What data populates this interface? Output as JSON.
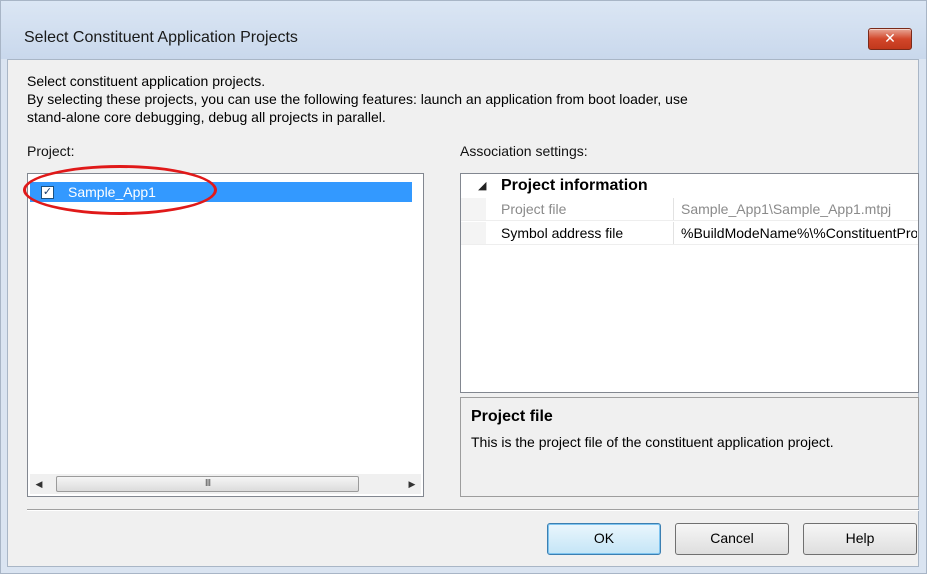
{
  "window": {
    "title": "Select Constituent Application Projects",
    "close_glyph": "✕"
  },
  "description": {
    "line1": "Select constituent application projects.",
    "line2": "By selecting these projects, you can use the following features: launch an application from boot loader, use",
    "line3": "stand-alone core debugging, debug all projects in parallel."
  },
  "project_panel": {
    "label": "Project:",
    "items": [
      {
        "name": "Sample_App1",
        "checked": true,
        "check_glyph": "✓"
      }
    ],
    "scroll_thumb_glyph": "III",
    "scroll_left_glyph": "◀",
    "scroll_right_glyph": "▶"
  },
  "association_panel": {
    "label": "Association settings:",
    "category": "Project information",
    "collapse_glyph": "◢",
    "rows": [
      {
        "key": "Project file",
        "value": "Sample_App1\\Sample_App1.mtpj",
        "disabled": true
      },
      {
        "key": "Symbol address file",
        "value": "%BuildModeName%\\%ConstituentProject%",
        "disabled": false
      }
    ]
  },
  "property_description": {
    "title": "Project file",
    "text": "This is the project file of the constituent application project."
  },
  "buttons": {
    "ok": "OK",
    "cancel": "Cancel",
    "help": "Help"
  },
  "colors": {
    "selection": "#3399ff",
    "annotation_circle": "#e01919"
  }
}
